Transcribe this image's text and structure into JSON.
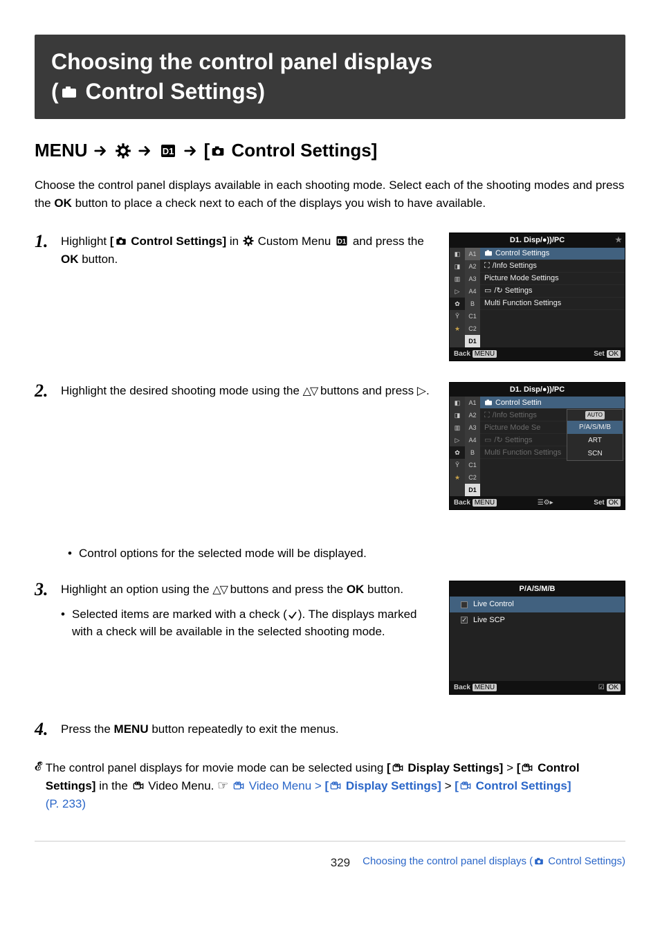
{
  "title_line1": "Choosing the control panel displays",
  "title_line2_prefix": "(",
  "title_line2_text": " Control Settings)",
  "breadcrumb": {
    "menu": "MENU",
    "trail_icon1": "gear",
    "trail_icon2": "D1",
    "final_prefix": "[",
    "final_text": " Control Settings]"
  },
  "intro_a": "Choose the control panel displays available in each shooting mode. Select each of the shooting modes and press the ",
  "intro_ok": "OK",
  "intro_b": " button to place a check next to each of the displays you wish to have available.",
  "steps": {
    "s1": {
      "num": "1.",
      "a": "Highlight ",
      "b_prefix": "[",
      "b_text": " Control Settings]",
      "c": " in ",
      "d": " Custom Menu ",
      "e": " and press the ",
      "ok": "OK",
      "f": " button."
    },
    "s2": {
      "num": "2.",
      "a": "Highlight the desired shooting mode using the ",
      "b": " buttons and press ",
      "c": "."
    },
    "s2_sub": "Control options for the selected mode will be displayed.",
    "s3": {
      "num": "3.",
      "a": "Highlight an option using the ",
      "b": " buttons and press the ",
      "ok": "OK",
      "c": " button.",
      "sub_a": "Selected items are marked with a check (",
      "sub_b": "). The displays marked with a check will be available in the selected shooting mode."
    },
    "s4": {
      "num": "4.",
      "a": "Press the ",
      "menu": "MENU",
      "b": " button repeatedly to exit the menus."
    }
  },
  "note": {
    "a": "The control panel displays for movie mode can be selected using ",
    "b_prefix": "[",
    "b_text": " Display Settings]",
    "c": " > ",
    "d_prefix": "[",
    "d_text": " Control Settings]",
    "e": " in the ",
    "f": " Video Menu. ",
    "g": " Video Menu > ",
    "h_prefix": "[",
    "h_text": " Display Settings]",
    "i": " > ",
    "j_prefix": "[",
    "j_text": " Control Settings]",
    "k": " (P. 233)"
  },
  "menu_sim": {
    "header": "D1. Disp/●))/PC",
    "sections": [
      "A1",
      "A2",
      "A3",
      "A4",
      "B",
      "C1",
      "C2",
      "D1"
    ],
    "items": [
      "Control Settings",
      "/Info Settings",
      "Picture Mode Settings",
      "/↻ Settings",
      "Multi Function Settings"
    ],
    "footer_back": "Back",
    "footer_back_btn": "MENU",
    "footer_mid": "",
    "footer_set": "Set",
    "footer_set_btn": "OK"
  },
  "menu_sim2": {
    "header": "D1. Disp/●))/PC",
    "popup": [
      "AUTO",
      "P/A/S/M/B",
      "ART",
      "SCN"
    ],
    "footer_mid": "☰⚙▸"
  },
  "check_sim": {
    "header": "P/A/S/M/B",
    "rows": [
      {
        "label": "Live Control",
        "checked": false,
        "sel": true
      },
      {
        "label": "Live SCP",
        "checked": true,
        "sel": false
      }
    ],
    "footer_back": "Back",
    "footer_back_btn": "MENU",
    "footer_set_btn": "OK"
  },
  "footer": {
    "page": "329",
    "title_a": "Choosing the control panel displays (",
    "title_b": " Control Settings)"
  }
}
